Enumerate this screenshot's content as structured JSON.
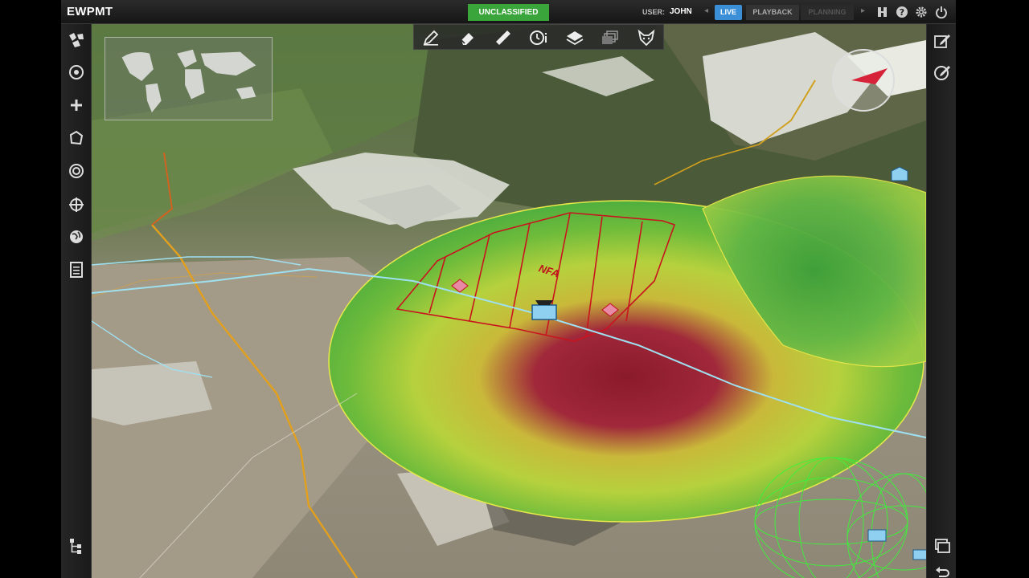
{
  "app": {
    "title": "EWPMT",
    "classification": "UNCLASSIFIED"
  },
  "user": {
    "label": "USER:",
    "name": "JOHN"
  },
  "modes": {
    "live": "LIVE",
    "playback": "PLAYBACK",
    "planning": "PLANNING"
  },
  "top_icons": [
    "network-icon",
    "help-icon",
    "settings-icon",
    "power-icon"
  ],
  "draw_toolbar": [
    "pencil-icon",
    "eraser-icon",
    "ruler-icon",
    "timer-info-icon",
    "layers-icon",
    "stacked-layers-icon",
    "fox-icon"
  ],
  "left_toolbar": [
    "unit-symbols-icon",
    "target-icon",
    "add-icon",
    "polygon-icon",
    "circle-target-icon",
    "crosshair-icon",
    "globe-icon",
    "document-icon",
    "hierarchy-icon"
  ],
  "right_toolbar": [
    "edit-note-icon",
    "edit-circle-icon",
    "window-icon",
    "undo-arrow-icon"
  ],
  "map": {
    "area_label": "NFA"
  },
  "colors": {
    "classification": "#3aa53a",
    "live": "#3b8fd6",
    "nfa": "#c0101a",
    "coverage_edge": "#e8e84a"
  }
}
